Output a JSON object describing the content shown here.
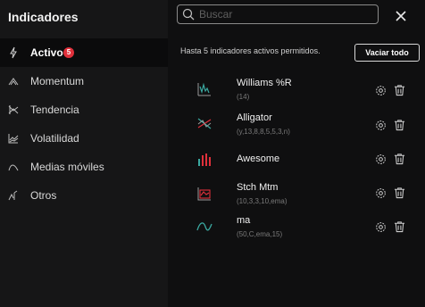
{
  "header": {
    "title": "Indicadores"
  },
  "search": {
    "placeholder": "Buscar",
    "value": ""
  },
  "sidebar": {
    "items": [
      {
        "label": "Activo",
        "badge": "5",
        "icon": "lightning-icon",
        "active": true
      },
      {
        "label": "Momentum",
        "icon": "momentum-icon"
      },
      {
        "label": "Tendencia",
        "icon": "trend-icon"
      },
      {
        "label": "Volatilidad",
        "icon": "volatility-icon"
      },
      {
        "label": "Medias móviles",
        "icon": "moving-average-icon"
      },
      {
        "label": "Otros",
        "icon": "others-icon"
      }
    ]
  },
  "main": {
    "limit_text": "Hasta 5 indicadores activos permitidos.",
    "clear_label": "Vaciar todo",
    "indicators": [
      {
        "name": "Williams %R",
        "params": "(14)",
        "icon": "williams-r-icon"
      },
      {
        "name": "Alligator",
        "params": "(y,13,8,8,5,5,3,n)",
        "icon": "alligator-icon"
      },
      {
        "name": "Awesome",
        "params": "",
        "icon": "awesome-oscillator-icon"
      },
      {
        "name": "Stch Mtm",
        "params": "(10,3,3,10,ema)",
        "icon": "stochastic-momentum-icon"
      },
      {
        "name": "ma",
        "params": "(50,C,ema,15)",
        "icon": "moving-average-icon"
      }
    ]
  },
  "colors": {
    "accent_red": "#e0303b",
    "icon_gray": "#9a9a9a",
    "icon_teal": "#3aa8a0"
  }
}
